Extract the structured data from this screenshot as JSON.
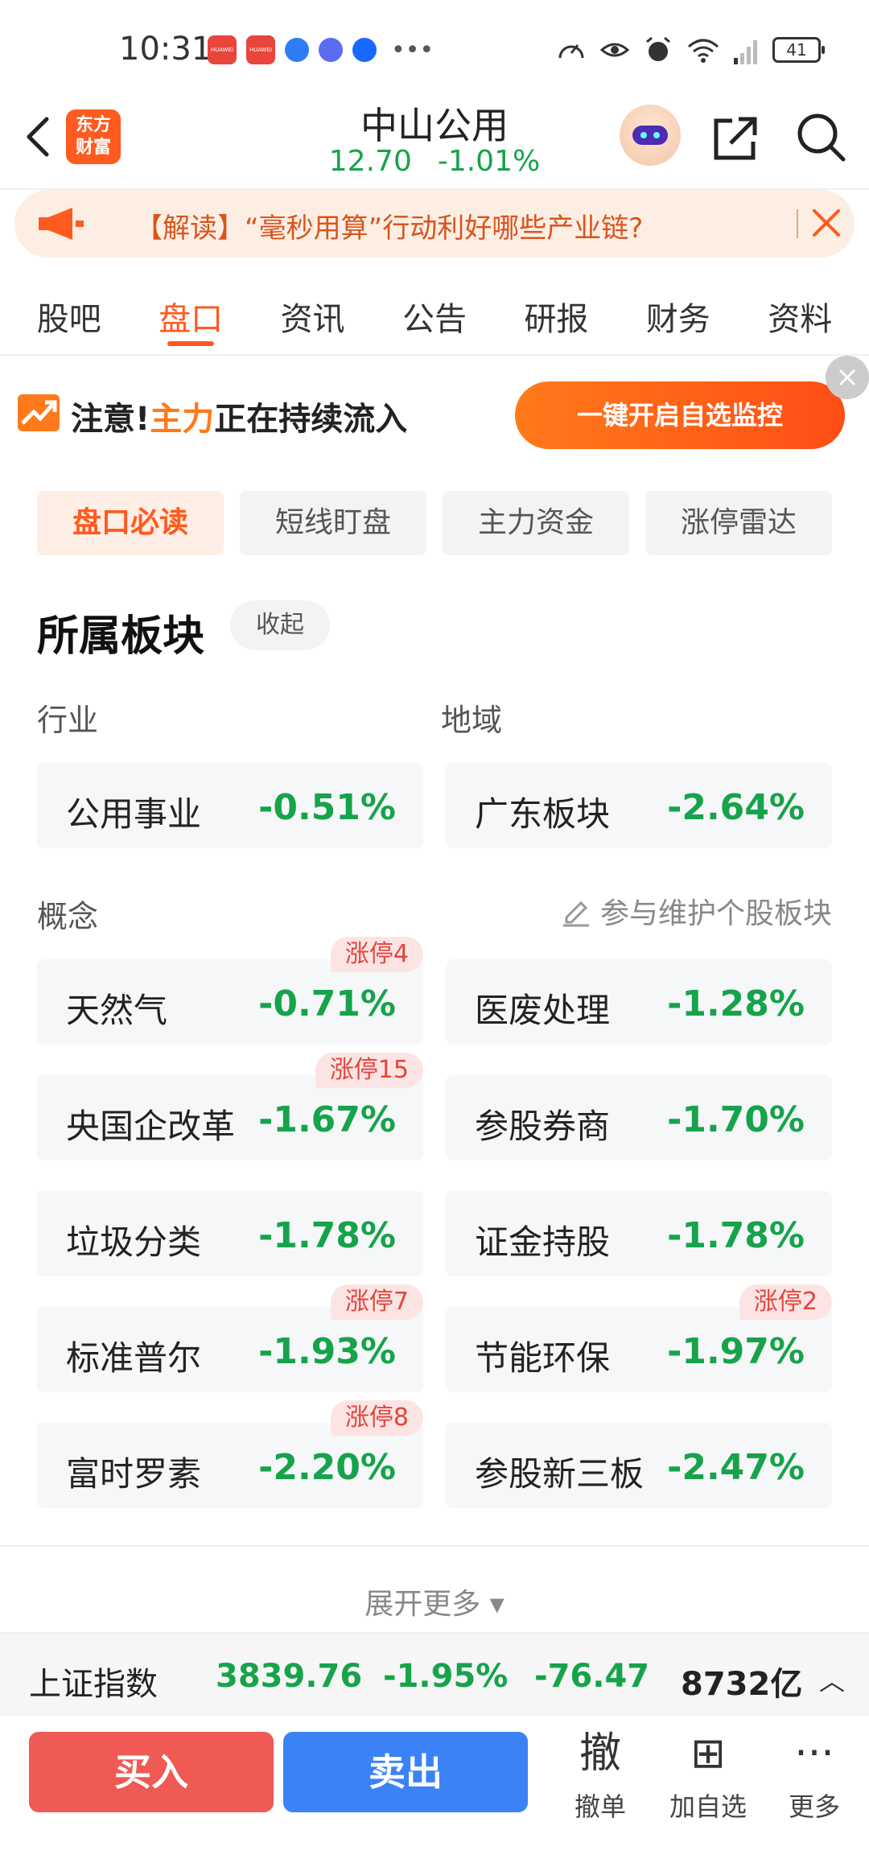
{
  "status_bar": {
    "time": "10:31",
    "battery": "41"
  },
  "header": {
    "logo_text": "东方\n财富",
    "stock_name": "中山公用",
    "price": "12.70",
    "change_pct": "-1.01%"
  },
  "notice": {
    "text": "【解读】“毫秒用算”行动利好哪些产业链?"
  },
  "tabs": [
    "股吧",
    "盘口",
    "资讯",
    "公告",
    "研报",
    "财务",
    "资料"
  ],
  "monitor": {
    "prefix": "注意!",
    "highlight": "主力",
    "suffix": "正在持续流入",
    "cta": "一键开启自选监控"
  },
  "subtabs": [
    "盘口必读",
    "短线盯盘",
    "主力资金",
    "涨停雷达"
  ],
  "sector": {
    "title": "所属板块",
    "collapse": "收起",
    "industry_label": "行业",
    "region_label": "地域",
    "concept_label": "概念",
    "maintain": "参与维护个股板块",
    "industry": {
      "name": "公用事业",
      "pct": "-0.51%"
    },
    "region": {
      "name": "广东板块",
      "pct": "-2.64%"
    },
    "concepts": [
      {
        "name": "天然气",
        "pct": "-0.71%",
        "badge": "涨停4"
      },
      {
        "name": "医废处理",
        "pct": "-1.28%",
        "badge": ""
      },
      {
        "name": "央国企改革",
        "pct": "-1.67%",
        "badge": "涨停15"
      },
      {
        "name": "参股券商",
        "pct": "-1.70%",
        "badge": ""
      },
      {
        "name": "垃圾分类",
        "pct": "-1.78%",
        "badge": ""
      },
      {
        "name": "证金持股",
        "pct": "-1.78%",
        "badge": ""
      },
      {
        "name": "标准普尔",
        "pct": "-1.93%",
        "badge": "涨停7"
      },
      {
        "name": "节能环保",
        "pct": "-1.97%",
        "badge": "涨停2"
      },
      {
        "name": "富时罗素",
        "pct": "-2.20%",
        "badge": "涨停8"
      },
      {
        "name": "参股新三板",
        "pct": "-2.47%",
        "badge": ""
      }
    ],
    "expand": "展开更多 ▾"
  },
  "index_bar": {
    "name": "上证指数",
    "value": "3839.76",
    "pct": "-1.95%",
    "change": "-76.47",
    "volume": "8732亿",
    "toggle": "︿"
  },
  "bottom": {
    "buy": "买入",
    "sell": "卖出",
    "cancel_icon": "撤",
    "cancel": "撤单",
    "add_icon": "⊞",
    "add": "加自选",
    "more_icon": "···",
    "more": "更多"
  },
  "colors": {
    "accent": "#ff5a1f",
    "down": "#16a34a",
    "up": "#e0463b",
    "buy": "#ef5a55",
    "sell": "#3b82f6"
  }
}
